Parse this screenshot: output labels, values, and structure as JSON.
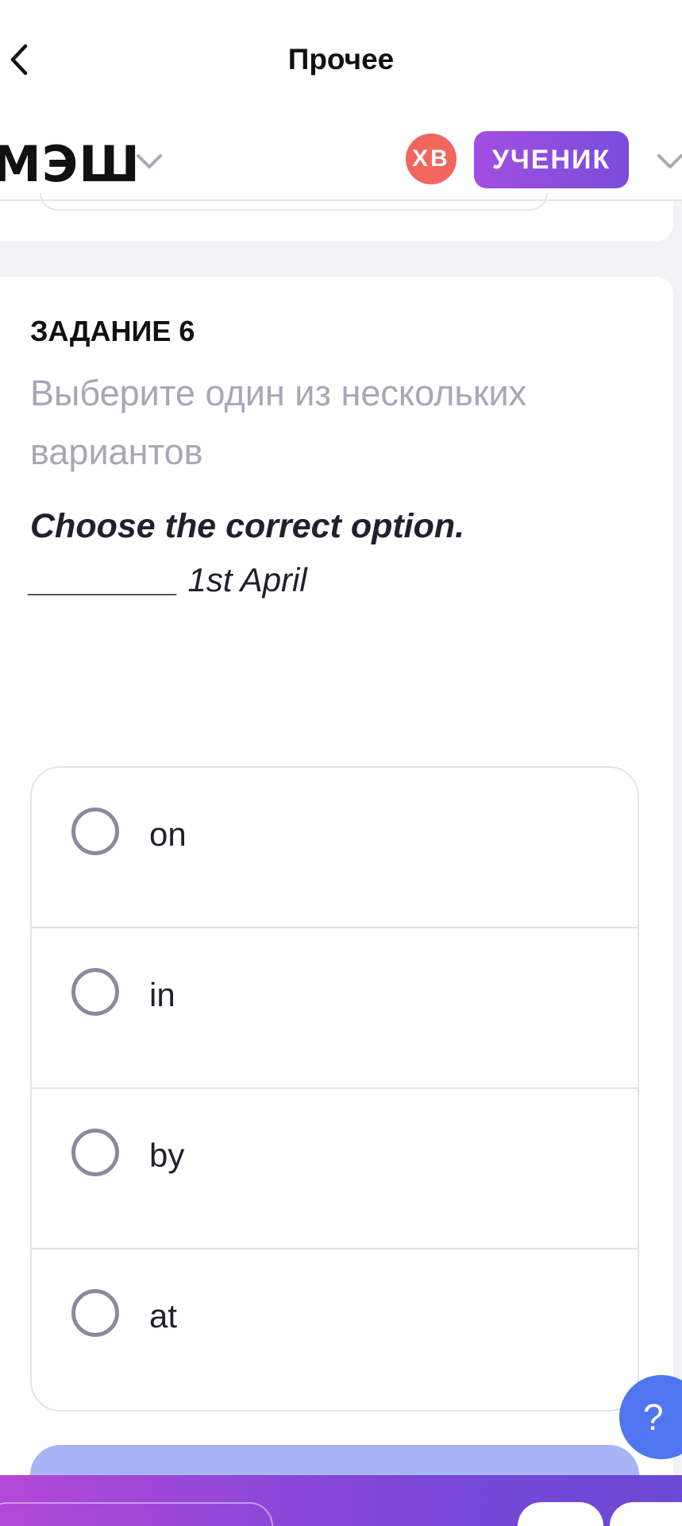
{
  "nav": {
    "title": "Прочее"
  },
  "header": {
    "logo": "МЭШ",
    "avatar_initials": "ХВ",
    "role": "УЧЕНИК"
  },
  "task": {
    "number_label": "ЗАДАНИЕ 6",
    "instruction": "Выберите один из нескольких вариантов",
    "question_title": "Choose the correct option.",
    "question_text": "________ 1st April",
    "options": [
      {
        "label": "on",
        "selected": false
      },
      {
        "label": "in",
        "selected": false
      },
      {
        "label": "by",
        "selected": false
      },
      {
        "label": "at",
        "selected": false
      }
    ]
  },
  "help": {
    "label": "?"
  },
  "colors": {
    "accent_purple": "#8a4ddc",
    "avatar_red": "#f2665e",
    "submit_disabled": "#a9b4f6",
    "help_blue": "#4f76f0"
  },
  "icons": {
    "back": "chevron-left-icon",
    "dropdown": "chevron-down-icon",
    "radio": "radio-empty-icon"
  }
}
